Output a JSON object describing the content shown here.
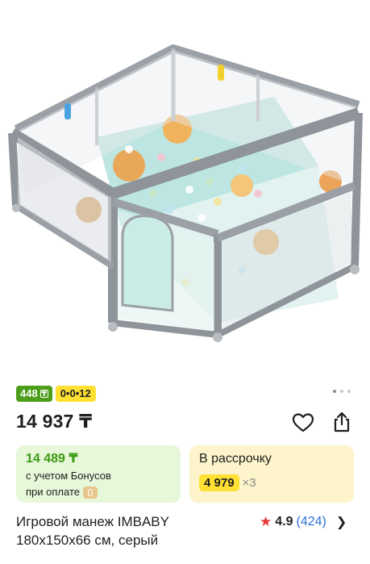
{
  "badges": {
    "price_badge": "448",
    "installment_badge": "0•0•12"
  },
  "price": {
    "main": "14 937 ₸"
  },
  "bonus_card": {
    "price": "14 489 ₸",
    "line1": "с учетом Бонусов",
    "line2": "при оплате"
  },
  "installment_card": {
    "title": "В рассрочку",
    "amount": "4 979",
    "multiplier": "×3"
  },
  "product": {
    "title_line1": "Игровой манеж IMBABY",
    "title_line2": "180x150x66 см, серый"
  },
  "rating": {
    "value": "4.9",
    "count": "(424)"
  },
  "icons": {
    "favorite": "heart-outline-icon",
    "share": "share-icon",
    "rating": "star-icon",
    "navigate": "chevron-right-icon",
    "payment": "wallet-icon"
  },
  "colors": {
    "price_badge": "#4d9e1a",
    "installment_badge": "#ffe033",
    "bonus_card_bg": "#e7f7d9",
    "bonus_price": "#3b9a12",
    "installment_card_bg": "#fdf4cc",
    "rating_star": "#e53935",
    "rating_count": "#2f6fd8"
  }
}
